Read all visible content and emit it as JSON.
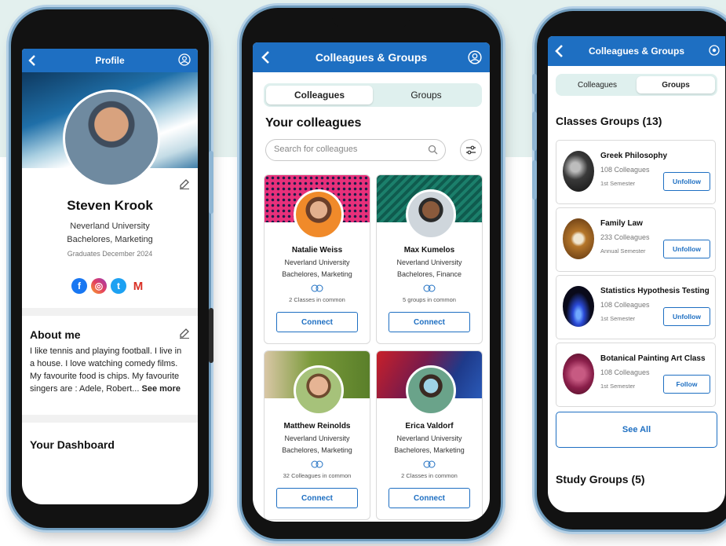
{
  "profile_screen": {
    "title": "Profile",
    "name": "Steven Krook",
    "university": "Neverland University",
    "degree": "Bachelores, Marketing",
    "graduation": "Graduates December 2024",
    "social_icons": [
      "facebook-icon",
      "instagram-icon",
      "twitter-icon",
      "gmail-icon"
    ],
    "about_title": "About me",
    "about_text": "I like tennis and playing football. I live in a house. I love watching comedy films. My favourite food is chips. My favourite singers are : Adele, Robert...",
    "see_more": "See more",
    "dashboard_title": "Your Dashboard"
  },
  "colleagues_screen": {
    "title": "Colleagues & Groups",
    "tabs": [
      "Colleagues",
      "Groups"
    ],
    "active_tab": "Colleagues",
    "heading": "Your colleagues",
    "search_placeholder": "Search for colleagues",
    "colleagues": [
      {
        "name": "Natalie Weiss",
        "university": "Neverland University",
        "degree": "Bachelores, Marketing",
        "common": "2 Classes in common",
        "action": "Connect"
      },
      {
        "name": "Max Kumelos",
        "university": "Neverland University",
        "degree": "Bachelores, Finance",
        "common": "5 groups in common",
        "action": "Connect"
      },
      {
        "name": "Matthew Reinolds",
        "university": "Neverland University",
        "degree": "Bachelores, Marketing",
        "common": "32  Colleagues in common",
        "action": "Connect"
      },
      {
        "name": "Erica Valdorf",
        "university": "Neverland University",
        "degree": "Bachelores, Marketing",
        "common": "2 Classes in common",
        "action": "Connect"
      }
    ]
  },
  "groups_screen": {
    "title": "Colleagues & Groups",
    "tabs": [
      "Colleagues",
      "Groups"
    ],
    "active_tab": "Groups",
    "classes_title": "Classes Groups (13)",
    "groups": [
      {
        "name": "Greek Philosophy",
        "count": "108 Colleagues",
        "semester": "1st Semester",
        "action": "Unfollow"
      },
      {
        "name": "Family Law",
        "count": "233 Colleagues",
        "semester": "Annual Semester",
        "action": "Unfollow"
      },
      {
        "name": "Statistics Hypothesis Testing",
        "count": "108 Colleagues",
        "semester": "1st Semester",
        "action": "Unfollow"
      },
      {
        "name": "Botanical Painting Art Class",
        "count": "108 Colleagues",
        "semester": "1st Semester",
        "action": "Follow"
      }
    ],
    "see_all": "See All",
    "study_title": "Study Groups (5)"
  },
  "colors": {
    "accent": "#1e6fc2",
    "segment_bg": "#dff0ee",
    "background_band": "#e3f0ee"
  }
}
